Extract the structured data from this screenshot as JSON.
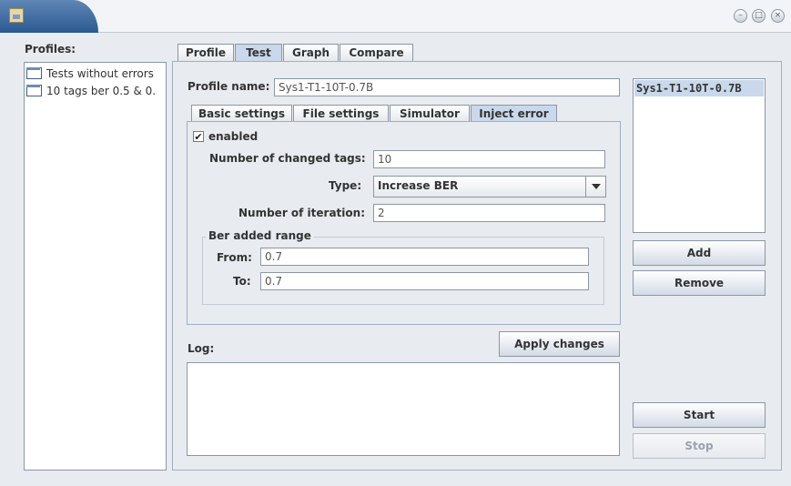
{
  "window": {
    "buttons": [
      "minimize-icon",
      "maximize-icon",
      "close-icon"
    ]
  },
  "profiles": {
    "label": "Profiles:",
    "items": [
      "Tests without errors",
      "10 tags ber 0.5 & 0."
    ]
  },
  "main_tabs": [
    "Profile",
    "Test",
    "Graph",
    "Compare"
  ],
  "active_main_tab": "Test",
  "profile_name": {
    "label": "Profile name:",
    "value": "Sys1-T1-10T-0.7B"
  },
  "sub_tabs": [
    "Basic settings",
    "File settings",
    "Simulator",
    "Inject error"
  ],
  "active_sub_tab": "Inject error",
  "inject_error": {
    "enabled_label": "enabled",
    "enabled_checked": true,
    "changed_tags_label": "Number of changed tags:",
    "changed_tags_value": "10",
    "type_label": "Type:",
    "type_value": "Increase BER",
    "iteration_label": "Number of iteration:",
    "iteration_value": "2",
    "ber_range": {
      "title": "Ber added range",
      "from_label": "From:",
      "from_value": "0.7",
      "to_label": "To:",
      "to_value": "0.7"
    }
  },
  "apply_button": "Apply changes",
  "log_label": "Log:",
  "right_list": [
    "Sys1-T1-10T-0.7B"
  ],
  "buttons": {
    "add": "Add",
    "remove": "Remove",
    "start": "Start",
    "stop": "Stop"
  },
  "colors": {
    "titlebar_accent": "#2b5a92",
    "selected_bg": "#c9d8ea"
  }
}
